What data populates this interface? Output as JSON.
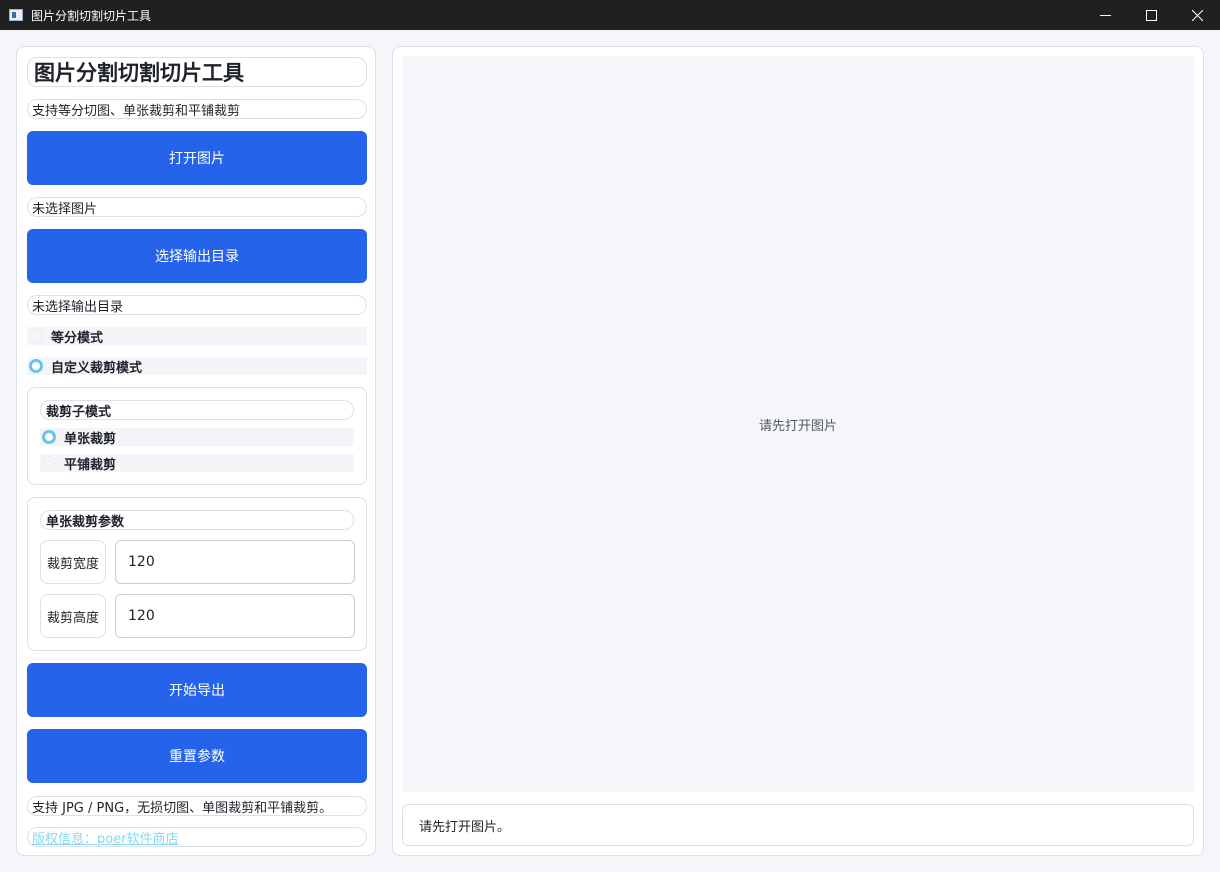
{
  "window": {
    "title": "图片分割切割切片工具",
    "controls": [
      "minimize",
      "maximize",
      "close"
    ]
  },
  "sidebar": {
    "heading": "图片分割切割切片工具",
    "subtitle": "支持等分切图、单张裁剪和平铺裁剪",
    "open_image_label": "打开图片",
    "image_status": "未选择图片",
    "choose_output_label": "选择输出目录",
    "output_status": "未选择输出目录",
    "modes": [
      {
        "label": "等分模式",
        "selected": false
      },
      {
        "label": "自定义裁剪模式",
        "selected": true
      }
    ],
    "crop_submode": {
      "title": "裁剪子模式",
      "options": [
        {
          "label": "单张裁剪",
          "selected": true
        },
        {
          "label": "平铺裁剪",
          "selected": false
        }
      ]
    },
    "single_crop_params": {
      "title": "单张裁剪参数",
      "width_label": "裁剪宽度",
      "width_value": "120",
      "height_label": "裁剪高度",
      "height_value": "120"
    },
    "export_label": "开始导出",
    "reset_label": "重置参数",
    "footer_note": "支持 JPG / PNG，无损切图、单图裁剪和平铺裁剪。",
    "copyright": "版权信息：poer软件商店"
  },
  "main": {
    "preview_placeholder": "请先打开图片",
    "status_message": "请先打开图片。"
  },
  "colors": {
    "accent": "#2563eb",
    "radio_selected": "#6ac4ea",
    "link": "#8cd4ee",
    "titlebar": "#202020"
  }
}
